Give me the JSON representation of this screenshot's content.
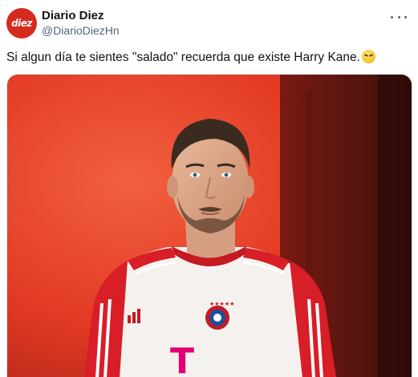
{
  "tweet": {
    "display_name": "Diario Diez",
    "handle": "@DiarioDiezHn",
    "avatar_text": "diez",
    "text": "Si algun día te sientes \"salado\" recuerda que existe Harry Kane.",
    "emoji_icon": "grimacing-sweat-emoji"
  },
  "colors": {
    "brand_red": "#d52b1e",
    "text_primary": "#0f1419",
    "text_secondary": "#536471",
    "photo_background": "#e8432a",
    "jersey_red": "#dc1f26"
  },
  "media": {
    "jersey_letter": "T"
  }
}
